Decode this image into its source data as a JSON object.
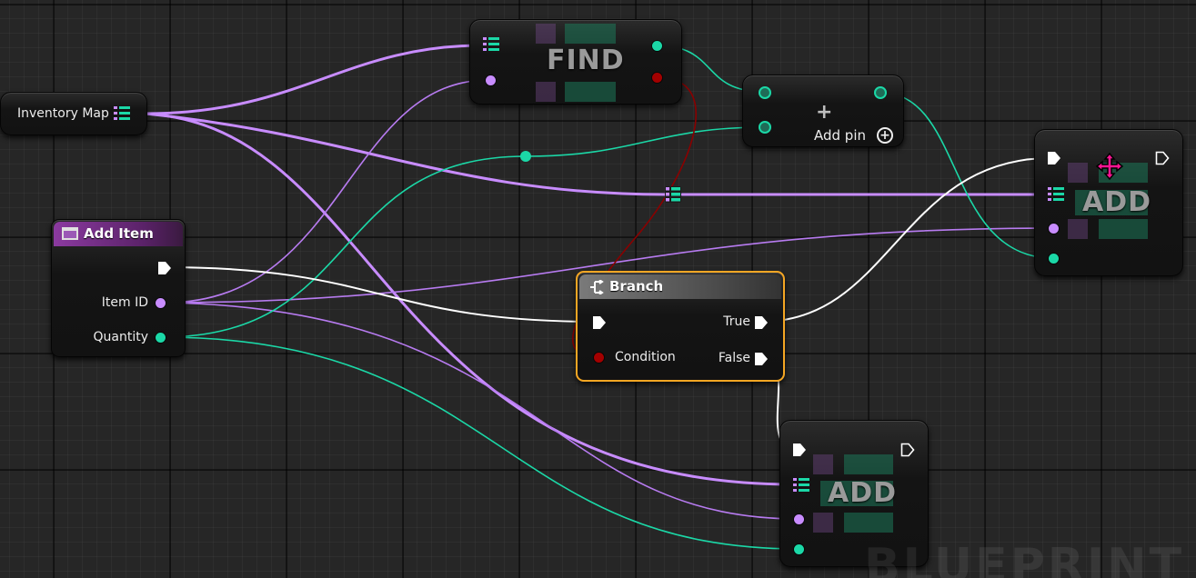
{
  "graph": {
    "watermark": "BLUEPRINT"
  },
  "nodes": {
    "inventory_map": {
      "label": "Inventory Map"
    },
    "add_item": {
      "title": "Add Item",
      "pins": {
        "item_id": "Item ID",
        "quantity": "Quantity"
      }
    },
    "find": {
      "title": "FIND"
    },
    "add_pin": {
      "label": "Add pin"
    },
    "branch": {
      "title": "Branch",
      "pins": {
        "condition": "Condition",
        "true": "True",
        "false": "False"
      }
    },
    "add_top": {
      "title": "ADD"
    },
    "add_bottom": {
      "title": "ADD"
    }
  },
  "icons": [
    "map-grid-icon",
    "event-node-icon",
    "branch-icon",
    "plus-icon",
    "add-circle-icon",
    "move-cursor-icon"
  ],
  "colors": {
    "map_wire": "#c88cff",
    "int_wire": "#1bd8a7",
    "bool_wire": "#a30000",
    "exec_wire": "#ffffff",
    "event_header": "#7a2f8c",
    "branch_header": "#6a6a6a",
    "selection": "#f5a623"
  }
}
